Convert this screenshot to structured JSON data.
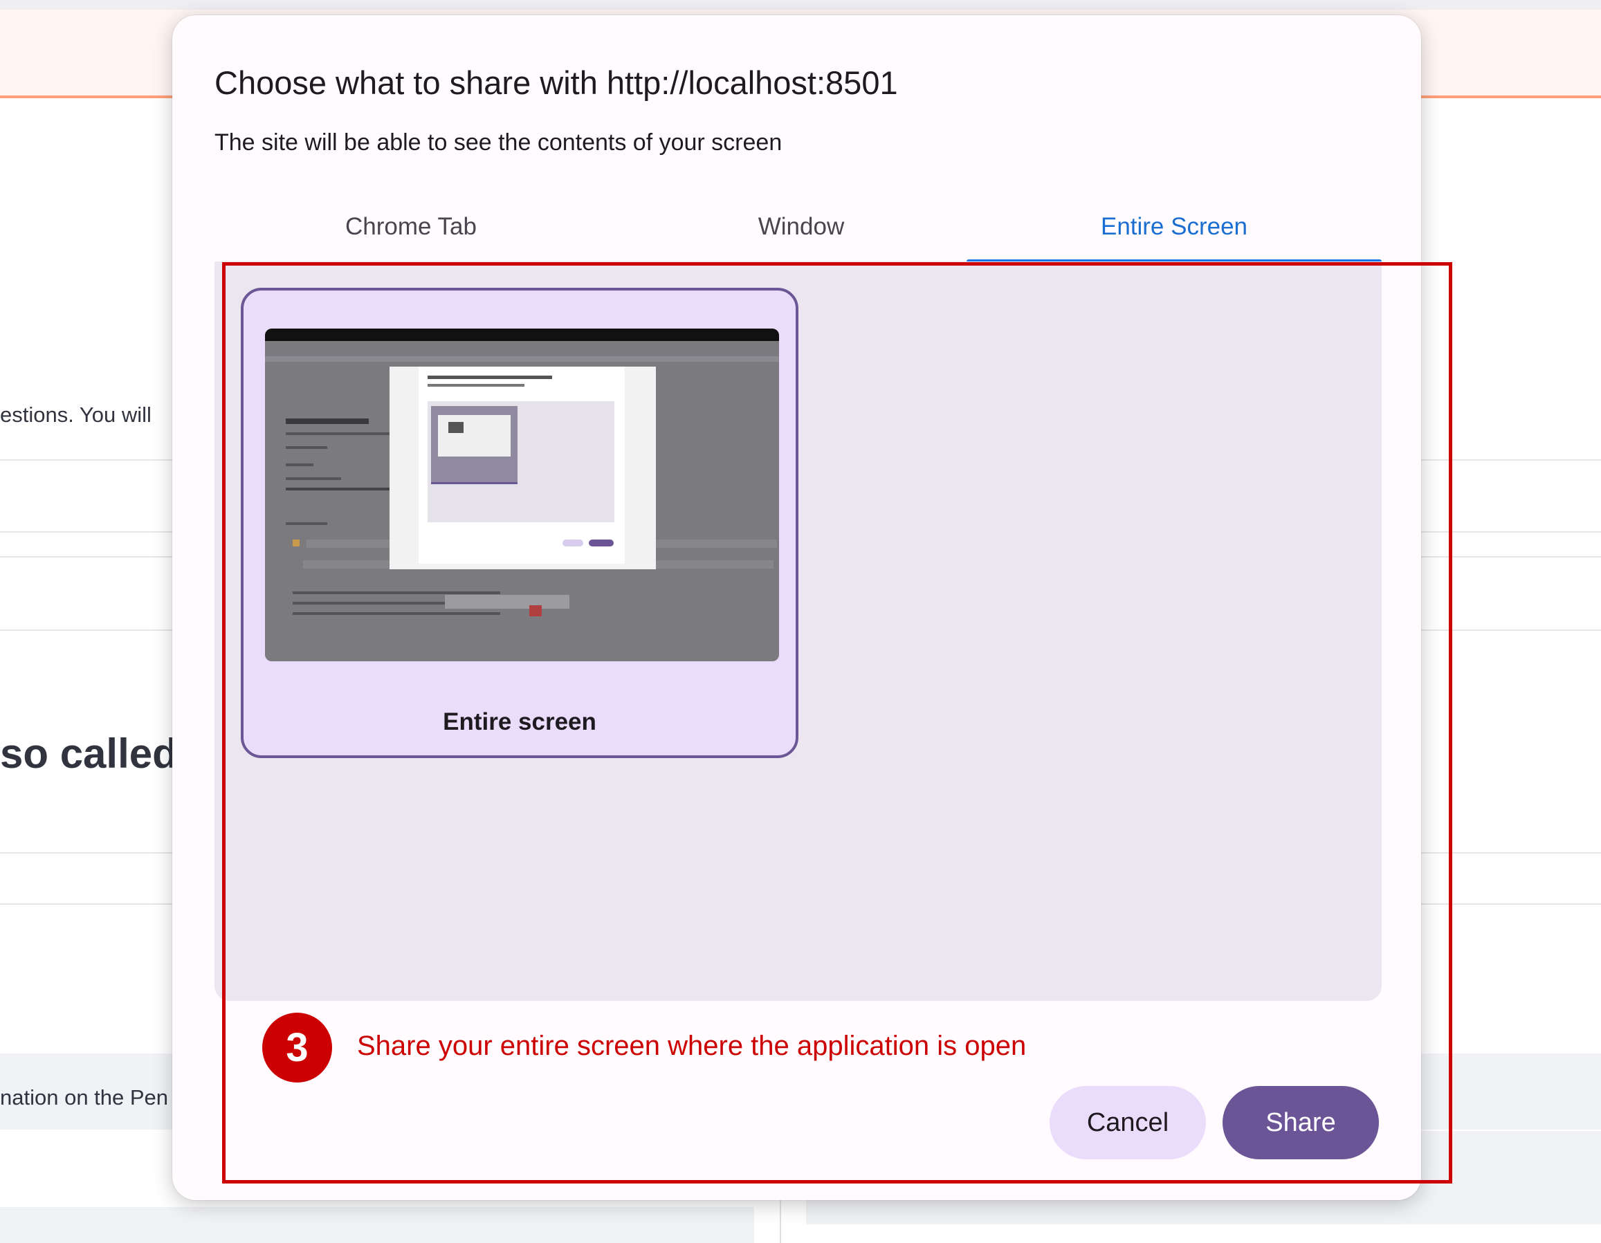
{
  "background": {
    "text_1": "estions. You will",
    "text_2": "so called a",
    "text_3": "nation on the Pen"
  },
  "dialog": {
    "title": "Choose what to share with http://localhost:8501",
    "subtitle": "The site will be able to see the contents of your screen",
    "tabs": [
      {
        "label": "Chrome Tab",
        "selected": false
      },
      {
        "label": "Window",
        "selected": false
      },
      {
        "label": "Entire Screen",
        "selected": true
      }
    ],
    "sources": [
      {
        "label": "Entire screen",
        "selected": true
      }
    ],
    "cancel_label": "Cancel",
    "share_label": "Share"
  },
  "annotation": {
    "step": "3",
    "text": "Share your entire screen where the application is open",
    "color": "#cc0000"
  },
  "colors": {
    "accent_tab": "#1a73e8",
    "primary_button": "#6b5596",
    "tonal_button": "#eadcfb"
  }
}
